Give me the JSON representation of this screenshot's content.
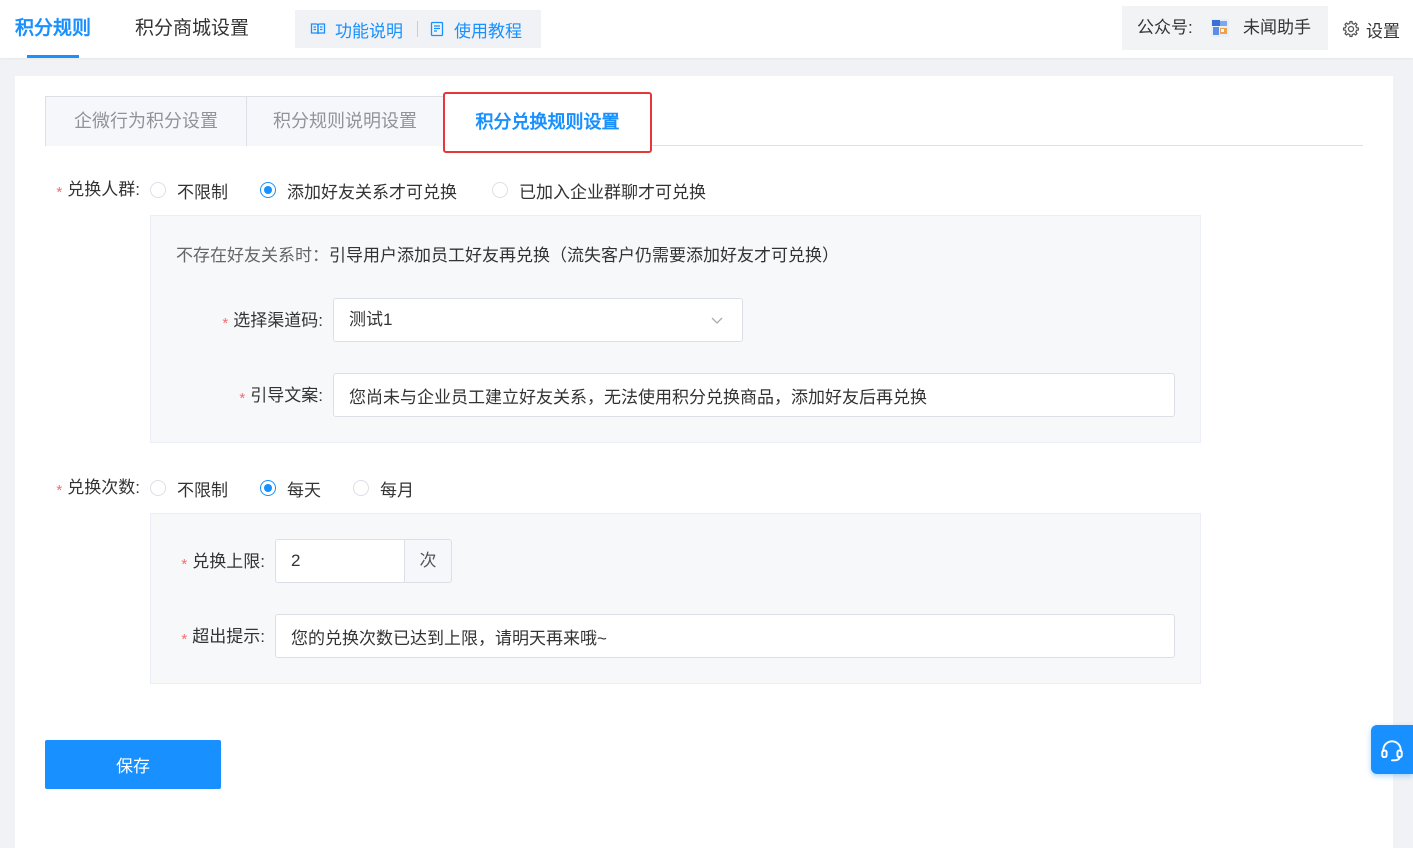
{
  "header": {
    "tabs": [
      {
        "label": "积分规则",
        "active": true
      },
      {
        "label": "积分商城设置",
        "active": false
      }
    ],
    "help_links": [
      {
        "label": "功能说明",
        "icon": "book-icon"
      },
      {
        "label": "使用教程",
        "icon": "document-icon"
      }
    ],
    "account": {
      "label": "公众号:",
      "name": "未闻助手",
      "avatar_icon": "avatar-icon"
    },
    "settings": {
      "label": "设置",
      "icon": "gear-icon"
    }
  },
  "sub_tabs": [
    {
      "label": "企微行为积分设置",
      "active": false,
      "highlighted": false
    },
    {
      "label": "积分规则说明设置",
      "active": false,
      "highlighted": false
    },
    {
      "label": "积分兑换规则设置",
      "active": true,
      "highlighted": true
    }
  ],
  "form": {
    "audience": {
      "required": "*",
      "label": "兑换人群:",
      "options": [
        {
          "label": "不限制",
          "checked": false
        },
        {
          "label": "添加好友关系才可兑换",
          "checked": true
        },
        {
          "label": "已加入企业群聊才可兑换",
          "checked": false
        }
      ]
    },
    "friend_settings": {
      "note_label": "不存在好友关系时：",
      "note_text": "引导用户添加员工好友再兑换（流失客户仍需要添加好友才可兑换）",
      "channel": {
        "required": "*",
        "label": "选择渠道码:",
        "value": "测试1"
      },
      "guide_text": {
        "required": "*",
        "label": "引导文案:",
        "value": "您尚未与企业员工建立好友关系，无法使用积分兑换商品，添加好友后再兑换"
      }
    },
    "frequency": {
      "required": "*",
      "label": "兑换次数:",
      "options": [
        {
          "label": "不限制",
          "checked": false
        },
        {
          "label": "每天",
          "checked": true
        },
        {
          "label": "每月",
          "checked": false
        }
      ]
    },
    "limit_settings": {
      "limit": {
        "required": "*",
        "label": "兑换上限:",
        "value": "2",
        "unit": "次"
      },
      "exceed_tip": {
        "required": "*",
        "label": "超出提示:",
        "value": "您的兑换次数已达到上限，请明天再来哦~"
      }
    }
  },
  "actions": {
    "save_label": "保存"
  },
  "floating_help": {
    "icon": "headset-icon"
  },
  "colors": {
    "accent": "#1890ff",
    "required": "#f56c6c",
    "highlight": "#e5383b",
    "page_background": "#f0f2f5"
  }
}
